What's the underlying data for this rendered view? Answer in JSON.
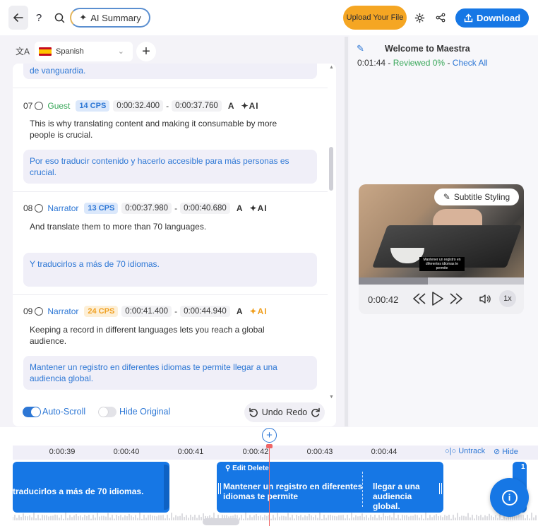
{
  "toolbar": {
    "help_label": "?",
    "ai_summary_label": "AI Summary",
    "upload_label": "Upload Your File",
    "download_label": "Download"
  },
  "language": {
    "selected": "Spanish"
  },
  "segments": {
    "partial_translation": "de vanguardia.",
    "items": [
      {
        "number": "07",
        "speaker": "Guest",
        "cps": "14 CPS",
        "start": "0:00:32.400",
        "end": "0:00:37.760",
        "ai_label": "AI",
        "original": "This is why translating content and making it consumable by more people is crucial.",
        "translation": "Por eso traducir contenido y hacerlo accesible para más personas es crucial."
      },
      {
        "number": "08",
        "speaker": "Narrator",
        "cps": "13 CPS",
        "start": "0:00:37.980",
        "end": "0:00:40.680",
        "ai_label": "AI",
        "original": "And translate them to more than 70 languages.",
        "translation": "Y traducirlos a más de 70 idiomas."
      },
      {
        "number": "09",
        "speaker": "Narrator",
        "cps": "24 CPS",
        "start": "0:00:41.400",
        "end": "0:00:44.940",
        "ai_label": "AI",
        "original": "Keeping a record in different languages lets you reach a global audience.",
        "translation": "Mantener un registro en diferentes idiomas te permite llegar a una audiencia global."
      }
    ],
    "dash": "-"
  },
  "controls": {
    "auto_scroll_label": "Auto-Scroll",
    "auto_scroll_on": true,
    "hide_original_label": "Hide Original",
    "hide_original_on": false,
    "undo_label": "Undo",
    "redo_label": "Redo"
  },
  "right_panel": {
    "title": "Welcome to Maestra",
    "duration": "0:01:44",
    "separator": "-",
    "reviewed": "Reviewed 0%",
    "check_all": "Check All",
    "subtitle_styling_label": "Subtitle Styling",
    "video_subtitle": "Mantener un registro en diferentes idiomas te permite",
    "current_time": "0:00:42",
    "speed": "1x",
    "progress": 0.42
  },
  "timeline": {
    "ticks": [
      "0:00:39",
      "0:00:40",
      "0:00:41",
      "0:00:42",
      "0:00:43",
      "0:00:44"
    ],
    "untrack_label": "Untrack",
    "hide_label": "Hide",
    "clip_a_text": "traducirlos a más de 70 idiomas.",
    "clip_b_header": "Edit Delete",
    "clip_b_text_1": "Mantener un registro en diferentes idiomas te permite",
    "clip_b_text_2": "llegar a una audiencia global.",
    "clip_c_text": "1"
  },
  "colors": {
    "accent": "#1677e5",
    "upload": "#f5a623",
    "guest": "#3aa85a",
    "narrator": "#2d77d5",
    "cps_warning": "#f0a021"
  }
}
